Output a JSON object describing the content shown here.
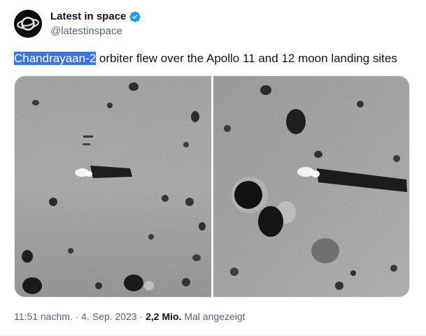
{
  "author": {
    "display_name": "Latest in space",
    "handle": "@latestinspace",
    "verified": true,
    "avatar_icon": "saturn-planet-logo-icon",
    "verified_color": "#1d9bf0"
  },
  "tweet": {
    "highlighted_text": "Chandrayaan-2",
    "text_rest": " orbiter flew over the Apollo 11 and 12 moon landing sites",
    "selection_color": "#3b73e3"
  },
  "media": {
    "photos": [
      {
        "description_icon": "lunar-surface-photo-apollo-11-site"
      },
      {
        "description_icon": "lunar-surface-photo-apollo-12-site"
      }
    ]
  },
  "meta": {
    "time": "11:51 nachm.",
    "sep1": " · ",
    "date": "4. Sep. 2023",
    "sep2": " · ",
    "views_count": "2,2 Mio.",
    "views_label": " Mal angezeigt"
  }
}
